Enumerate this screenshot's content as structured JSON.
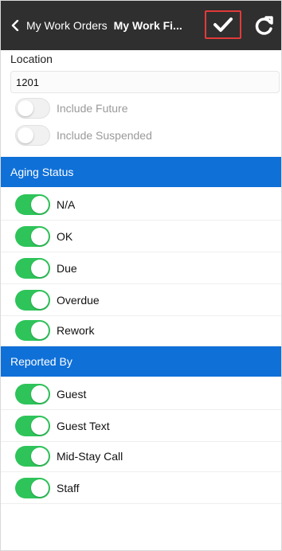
{
  "header": {
    "back_label": "My Work Orders",
    "title": "My Work Fi..."
  },
  "location": {
    "label": "Location",
    "value": "1201"
  },
  "options": [
    {
      "label": "Include Future",
      "on": false
    },
    {
      "label": "Include Suspended",
      "on": false
    }
  ],
  "aging": {
    "title": "Aging Status",
    "items": [
      {
        "label": "N/A",
        "on": true
      },
      {
        "label": "OK",
        "on": true
      },
      {
        "label": "Due",
        "on": true
      },
      {
        "label": "Overdue",
        "on": true
      },
      {
        "label": "Rework",
        "on": true
      }
    ]
  },
  "reported": {
    "title": "Reported By",
    "items": [
      {
        "label": "Guest",
        "on": true
      },
      {
        "label": "Guest Text",
        "on": true
      },
      {
        "label": "Mid-Stay Call",
        "on": true
      },
      {
        "label": "Staff",
        "on": true
      }
    ]
  },
  "colors": {
    "header": "#2f2f2f",
    "section": "#0f70d8",
    "toggle_on": "#2ec45a",
    "save_outline": "#e33a3a"
  }
}
